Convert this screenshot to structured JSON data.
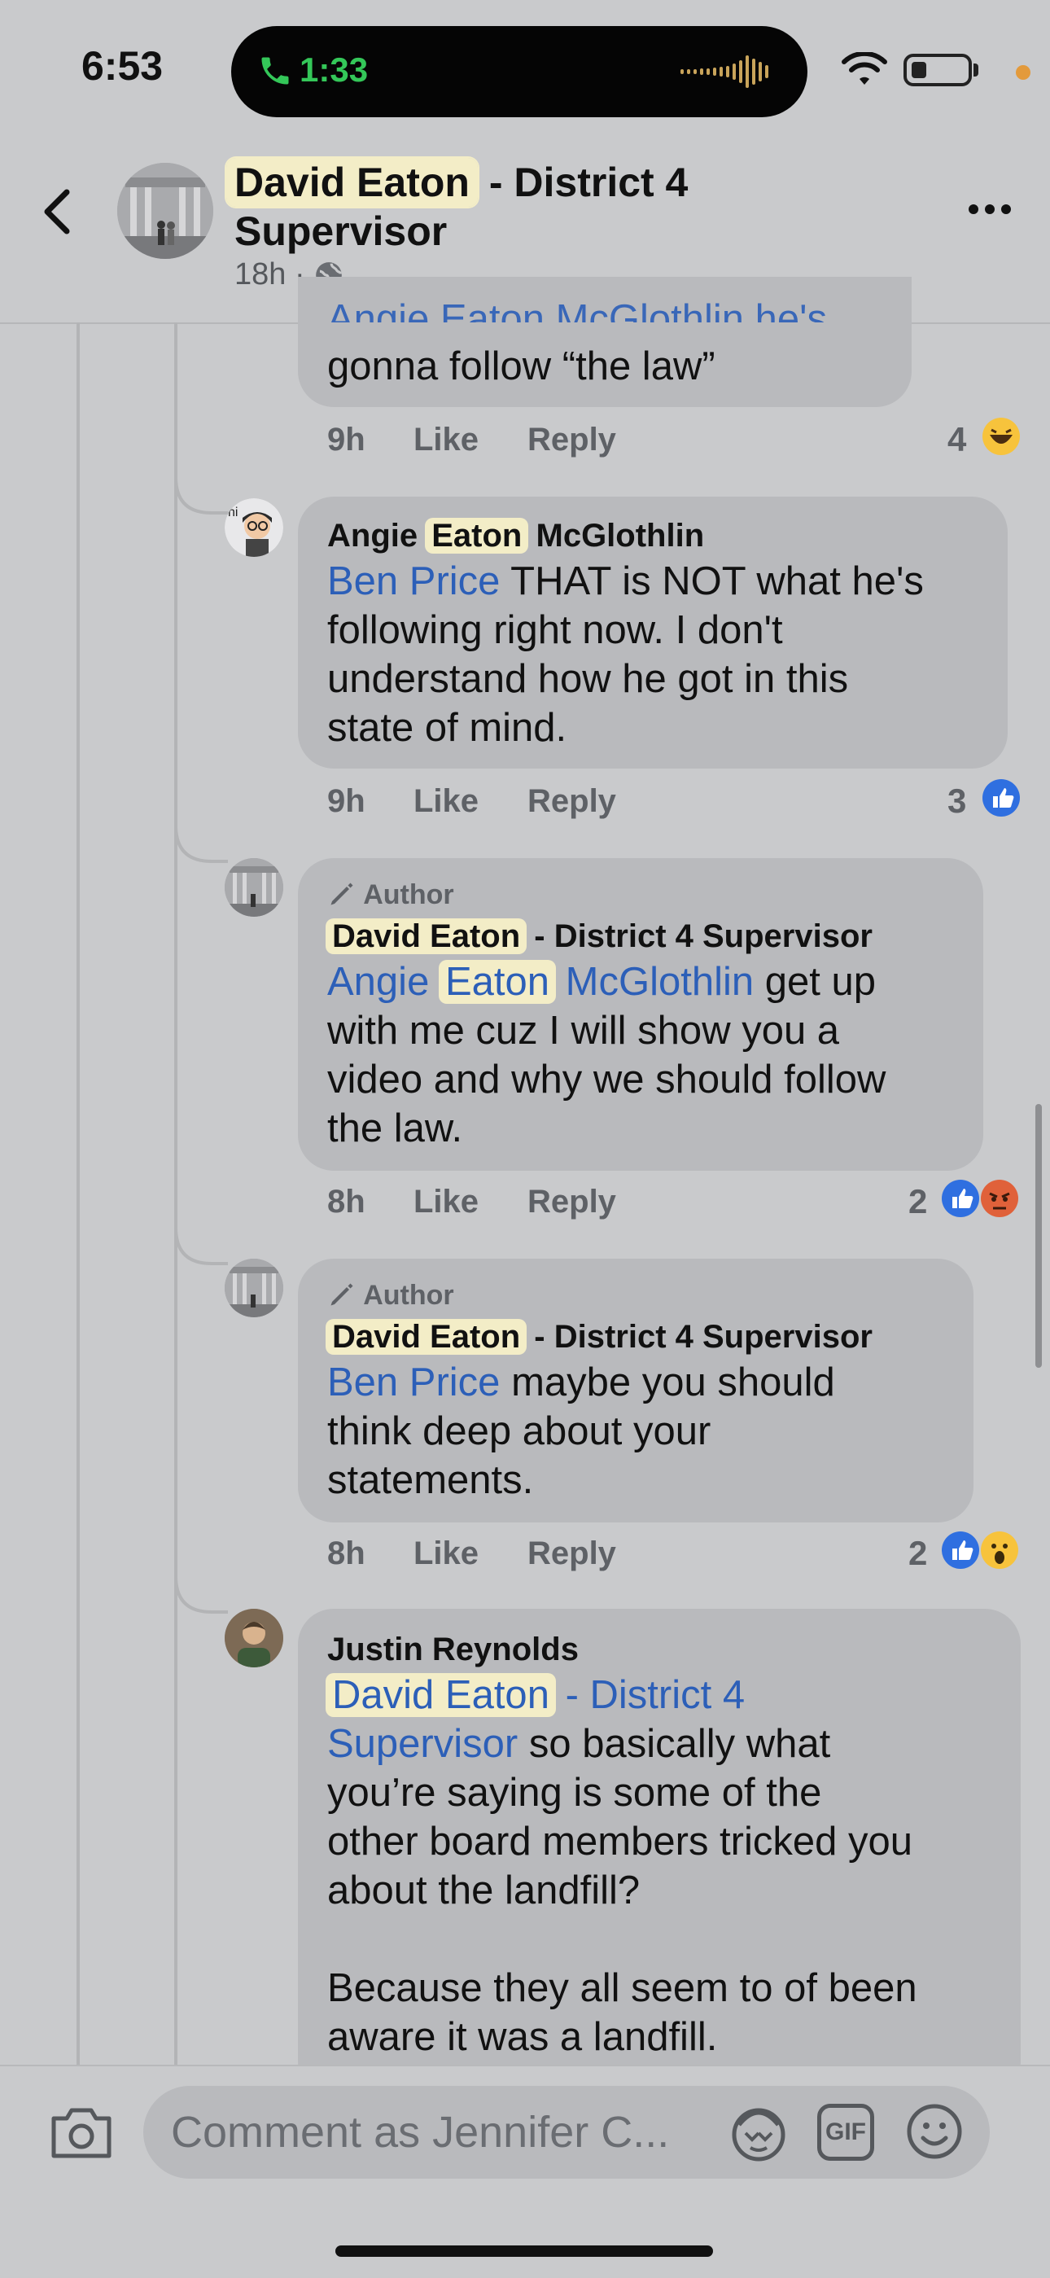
{
  "status_bar": {
    "time": "6:53",
    "call_time": "1:33"
  },
  "header": {
    "name_highlight": "David Eaton",
    "name_rest": "- District 4",
    "name_line2": "Supervisor",
    "meta": "18h ·",
    "more_label": "..."
  },
  "comments": [
    {
      "text_partial_top": "Angie Eaton McGlothlin he's",
      "text": "gonna follow “the law”",
      "time": "9h",
      "like": "Like",
      "reply": "Reply",
      "reactions": "4"
    },
    {
      "name_a": "Angie",
      "name_hl": "Eaton",
      "name_b": "McGlothlin",
      "mention": "Ben Price",
      "text1": "THAT is NOT what he's",
      "text2": "following right now. I don't",
      "text3": "understand how he got in this",
      "text4": "state of mind.",
      "time": "9h",
      "like": "Like",
      "reply": "Reply",
      "reactions": "3"
    },
    {
      "author_tag": "Author",
      "name_hl": "David Eaton",
      "name_rest": "- District 4 Supervisor",
      "mention_a": "Angie",
      "mention_hl": "Eaton",
      "mention_b": "McGlothlin",
      "text1": "get up",
      "text2": "with me cuz I will show you a",
      "text3": "video and why we should follow",
      "text4": "the law.",
      "time": "8h",
      "like": "Like",
      "reply": "Reply",
      "reactions": "2"
    },
    {
      "author_tag": "Author",
      "name_hl": "David Eaton",
      "name_rest": "- District 4 Supervisor",
      "mention": "Ben Price",
      "text1": "maybe you should",
      "text2": "think deep about your",
      "text3": "statements.",
      "time": "8h",
      "like": "Like",
      "reply": "Reply",
      "reactions": "2"
    },
    {
      "name": "Justin Reynolds",
      "mention_hl": "David Eaton",
      "mention_rest": "- District 4",
      "mention_line2": "Supervisor",
      "text1": "so basically what",
      "text2": "you’re saying is some of the",
      "text3": "other board members tricked you",
      "text4": "about the landfill?",
      "text5": "Because they all seem to of been",
      "text6": "aware it was a landfill."
    }
  ],
  "composer": {
    "placeholder": "Comment as Jennifer C...",
    "gif_label": "GIF"
  }
}
